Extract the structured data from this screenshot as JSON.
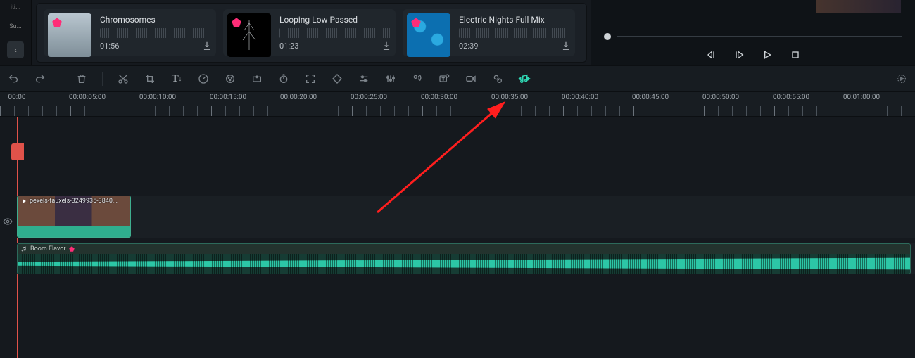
{
  "left_rail": {
    "label": "Su...",
    "back": "‹",
    "category_prefix": "iti..."
  },
  "media": {
    "items": [
      {
        "title": "Chromosomes",
        "duration": "01:56"
      },
      {
        "title": "Looping Low Passed",
        "duration": "01:23"
      },
      {
        "title": "Electric Nights Full Mix",
        "duration": "02:39"
      }
    ]
  },
  "toolbar": {
    "icons": [
      "undo",
      "redo",
      "delete",
      "cut",
      "crop",
      "text",
      "speed",
      "color",
      "keyframe",
      "timer",
      "fit",
      "tag",
      "adjust",
      "audio-mix",
      "voice",
      "subtitle-auto",
      "record",
      "smart-edit",
      "beat-detect"
    ],
    "highlighted": "beat-detect"
  },
  "ruler": {
    "labels": [
      "00:00",
      "00:00:05:00",
      "00:00:10:00",
      "00:00:15:00",
      "00:00:20:00",
      "00:00:25:00",
      "00:00:30:00",
      "00:00:35:00",
      "00:00:40:00",
      "00:00:45:00",
      "00:00:50:00",
      "00:00:55:00",
      "00:01:00:00"
    ]
  },
  "timeline": {
    "video_clip": {
      "label": "pexels-fauxels-3249935-3840..."
    },
    "audio_clip": {
      "label": "Boom Flavor"
    }
  },
  "playback": {
    "buttons": [
      "prev-frame",
      "play-in",
      "play",
      "stop"
    ]
  }
}
